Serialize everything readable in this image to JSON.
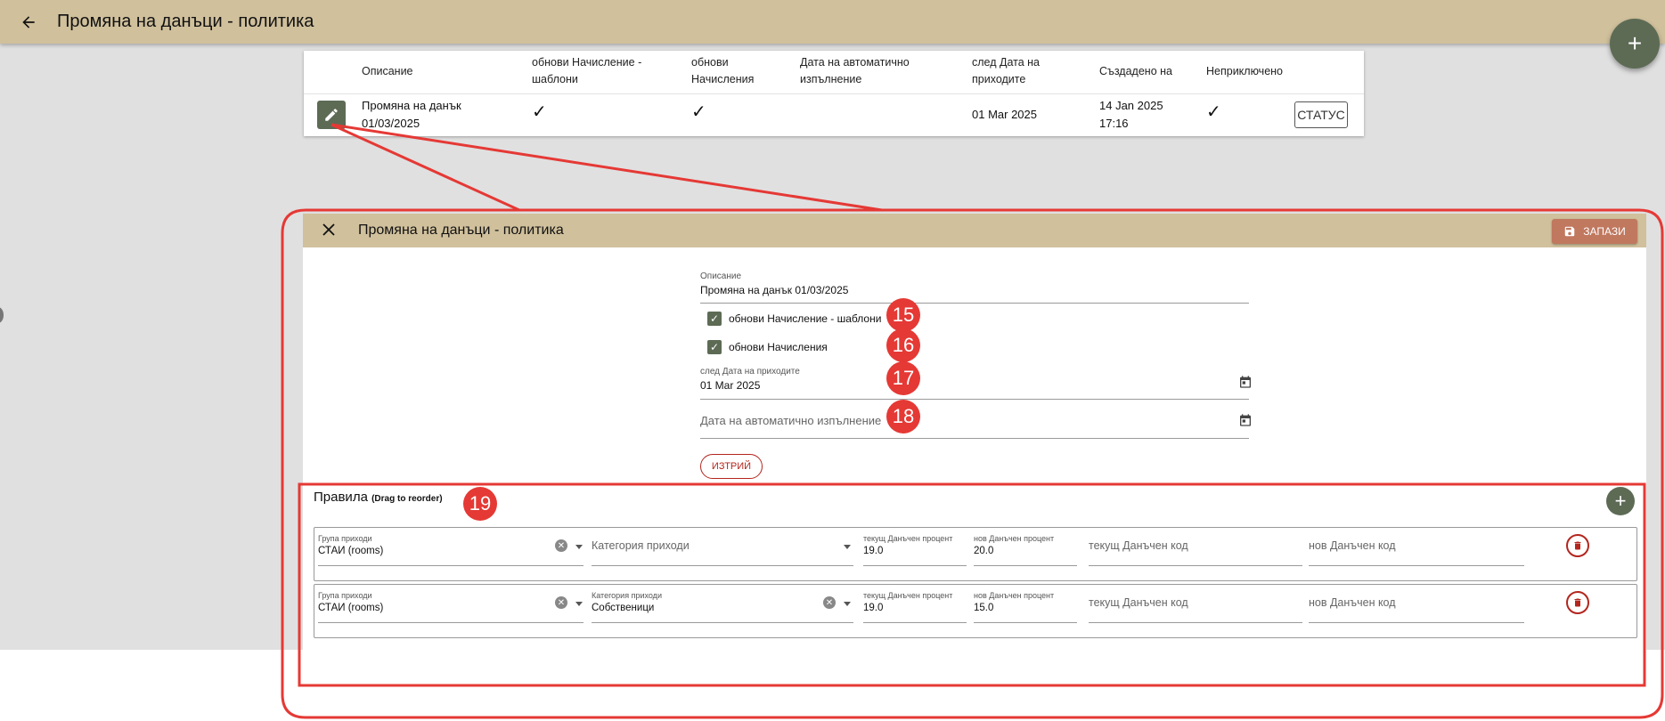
{
  "appbar": {
    "title": "Промяна на данъци - политика",
    "back_icon": "arrow-left-icon"
  },
  "fab": {
    "label": "+"
  },
  "table": {
    "headers": {
      "description": "Описание",
      "update_templates": "обнови Начисление - шаблони",
      "update_charges": "обнови Начисления",
      "auto_exec_date": "Дата на автоматично изпълнение",
      "after_revenue_date": "след Дата на приходите",
      "created_at": "Създадено на",
      "unfinished": "Неприключено"
    },
    "row": {
      "description_line1": "Промяна на данък",
      "description_line2": "01/03/2025",
      "update_templates": "✓",
      "update_charges": "✓",
      "after_revenue_date": "01 Mar 2025",
      "created_line1": "14 Jan 2025",
      "created_line2": "17:16",
      "unfinished": "✓",
      "status_button": "СТАТУС"
    }
  },
  "dialog": {
    "title": "Промяна на данъци - политика",
    "close_icon": "close-icon",
    "save_label": "ЗАПАЗИ",
    "description_label": "Описание",
    "description_value": "Промяна на данък 01/03/2025",
    "checkbox_templates_label": "обнови Начисление - шаблони",
    "checkbox_charges_label": "обнови Начисления",
    "revenue_date_label": "след Дата на приходите",
    "revenue_date_value": "01 Mar 2025",
    "auto_exec_placeholder": "Дата на автоматично изпълнение",
    "delete_label": "ИЗТРИЙ",
    "rules_title": "Правила",
    "rules_hint": "(Drag to reorder)",
    "rules": [
      {
        "group_label": "Група приходи",
        "group_value": "СТАИ (rooms)",
        "category_label": "",
        "category_value": "",
        "category_placeholder": "Категория приходи",
        "cur_pct_label": "текущ Данъчен процент",
        "cur_pct_value": "19.0",
        "new_pct_label": "нов Данъчен процент",
        "new_pct_value": "20.0",
        "cur_code_placeholder": "текущ Данъчен код",
        "new_code_placeholder": "нов Данъчен код"
      },
      {
        "group_label": "Група приходи",
        "group_value": "СТАИ (rooms)",
        "category_label": "Категория приходи",
        "category_value": "Собственици",
        "category_placeholder": "",
        "cur_pct_label": "текущ Данъчен процент",
        "cur_pct_value": "19.0",
        "new_pct_label": "нов Данъчен процент",
        "new_pct_value": "15.0",
        "cur_code_placeholder": "текущ Данъчен код",
        "new_code_placeholder": "нов Данъчен код"
      }
    ]
  },
  "annotations": {
    "badges": [
      "15",
      "16",
      "17",
      "18",
      "19"
    ],
    "color": "#e53935"
  },
  "colors": {
    "appbar": "#d0c09c",
    "accent": "#5d6b55",
    "save": "#c0785f",
    "danger": "#b3261e"
  }
}
